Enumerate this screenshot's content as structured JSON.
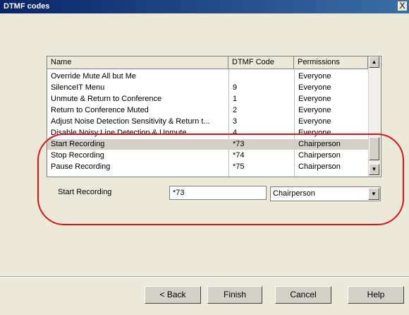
{
  "window": {
    "title": "DTMF codes",
    "close_glyph": "X"
  },
  "table": {
    "columns": [
      "Name",
      "DTMF Code",
      "Permissions"
    ],
    "rows": [
      {
        "name": "Override Mute All but Me",
        "code": "",
        "perm": "Everyone"
      },
      {
        "name": "SilenceIT Menu",
        "code": "9",
        "perm": "Everyone"
      },
      {
        "name": "Unmute & Return to Conference",
        "code": "1",
        "perm": "Everyone"
      },
      {
        "name": "Return to Conference Muted",
        "code": "2",
        "perm": "Everyone"
      },
      {
        "name": "Adjust Noise Detection Sensitivity & Return t...",
        "code": "3",
        "perm": "Everyone"
      },
      {
        "name": "Disable Noisy Line Detection & Unmute",
        "code": "4",
        "perm": "Everyone"
      },
      {
        "name": "Start Recording",
        "code": "*73",
        "perm": "Chairperson"
      },
      {
        "name": "Stop Recording",
        "code": "*74",
        "perm": "Chairperson"
      },
      {
        "name": "Pause Recording",
        "code": "*75",
        "perm": "Chairperson"
      }
    ],
    "selected_index": 6
  },
  "editor": {
    "name_label": "Start Recording",
    "code_value": "*73",
    "permission_value": "Chairperson"
  },
  "buttons": {
    "back": "< Back",
    "finish": "Finish",
    "cancel": "Cancel",
    "help": "Help"
  },
  "colors": {
    "title_bar": "#0A246A",
    "highlight_oval": "#E0101A",
    "dialog_bg": "#ECE9D8"
  }
}
